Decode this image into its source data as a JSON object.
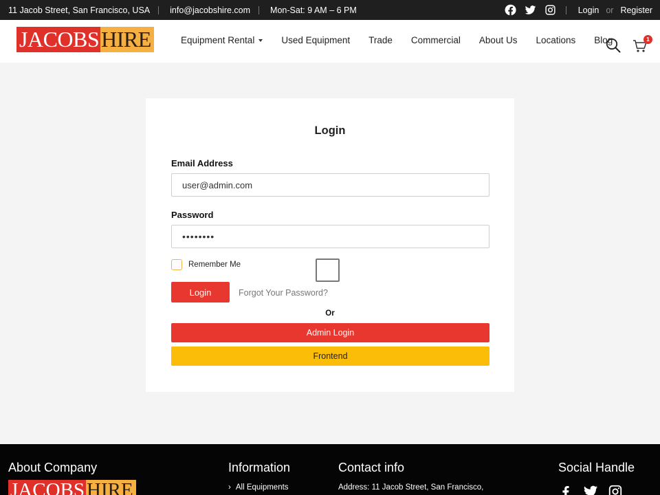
{
  "topbar": {
    "address": "11 Jacob Street, San Francisco, USA",
    "email": "info@jacobshire.com",
    "hours": "Mon-Sat: 9 AM – 6 PM",
    "social_icons": [
      "facebook-icon",
      "twitter-icon",
      "instagram-icon"
    ],
    "login": "Login",
    "or": "or",
    "register": "Register"
  },
  "brand": {
    "part1": "JACOBS",
    "part2": "HIRE",
    "color_red": "#e0302a",
    "color_orange": "#f5b041"
  },
  "nav": {
    "items": [
      "Equipment Rental",
      "Used Equipment",
      "Trade",
      "Commercial",
      "About Us",
      "Locations",
      "Blog"
    ],
    "cart_count": "1"
  },
  "login_form": {
    "title": "Login",
    "email_label": "Email Address",
    "email_value": "user@admin.com",
    "password_label": "Password",
    "password_value": "••••••••",
    "remember_label": "Remember Me",
    "login_button": "Login",
    "forgot_link": "Forgot Your Password?",
    "or_text": "Or",
    "admin_button": "Admin Login",
    "frontend_button": "Frontend",
    "accent_red": "#e8372f",
    "accent_yellow": "#fbbd08"
  },
  "footer": {
    "about_title": "About Company",
    "info_title": "Information",
    "info_first_link": "All Equipments",
    "contact_title": "Contact info",
    "address_line": "Address: 11 Jacob Street, San Francisco,",
    "social_title": "Social Handle"
  }
}
